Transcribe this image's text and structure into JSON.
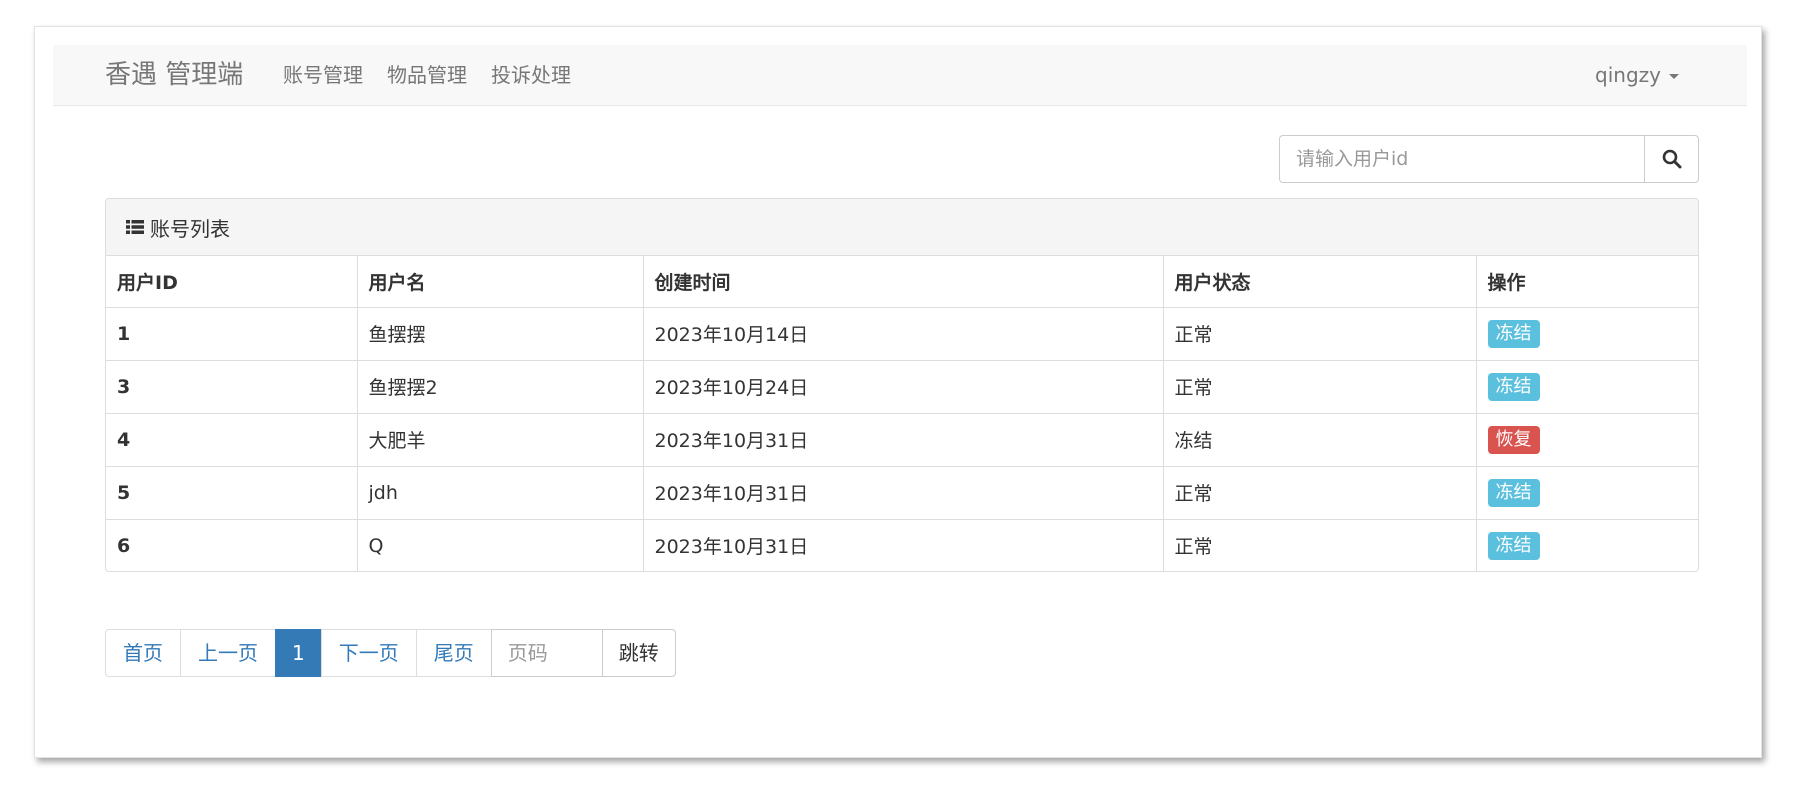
{
  "navbar": {
    "brand": "香遇 管理端",
    "links": [
      "账号管理",
      "物品管理",
      "投诉处理"
    ],
    "user": "qingzy"
  },
  "search": {
    "placeholder": "请输入用户id",
    "icon": "search-icon"
  },
  "panel": {
    "heading": "账号列表",
    "heading_icon": "list-icon"
  },
  "table": {
    "columns": [
      "用户ID",
      "用户名",
      "创建时间",
      "用户状态",
      "操作"
    ],
    "rows": [
      {
        "id": "1",
        "name": "鱼摆摆",
        "created": "2023年10月14日",
        "status": "正常",
        "action": "冻结",
        "action_style": "info"
      },
      {
        "id": "3",
        "name": "鱼摆摆2",
        "created": "2023年10月24日",
        "status": "正常",
        "action": "冻结",
        "action_style": "info"
      },
      {
        "id": "4",
        "name": "大肥羊",
        "created": "2023年10月31日",
        "status": "冻结",
        "action": "恢复",
        "action_style": "danger"
      },
      {
        "id": "5",
        "name": "jdh",
        "created": "2023年10月31日",
        "status": "正常",
        "action": "冻结",
        "action_style": "info"
      },
      {
        "id": "6",
        "name": "Q",
        "created": "2023年10月31日",
        "status": "正常",
        "action": "冻结",
        "action_style": "info"
      }
    ]
  },
  "pagination": {
    "first": "首页",
    "prev": "上一页",
    "current": "1",
    "next": "下一页",
    "last": "尾页",
    "page_placeholder": "页码",
    "jump": "跳转"
  },
  "colors": {
    "primary": "#337ab7",
    "info": "#5bc0de",
    "danger": "#d9534f"
  }
}
